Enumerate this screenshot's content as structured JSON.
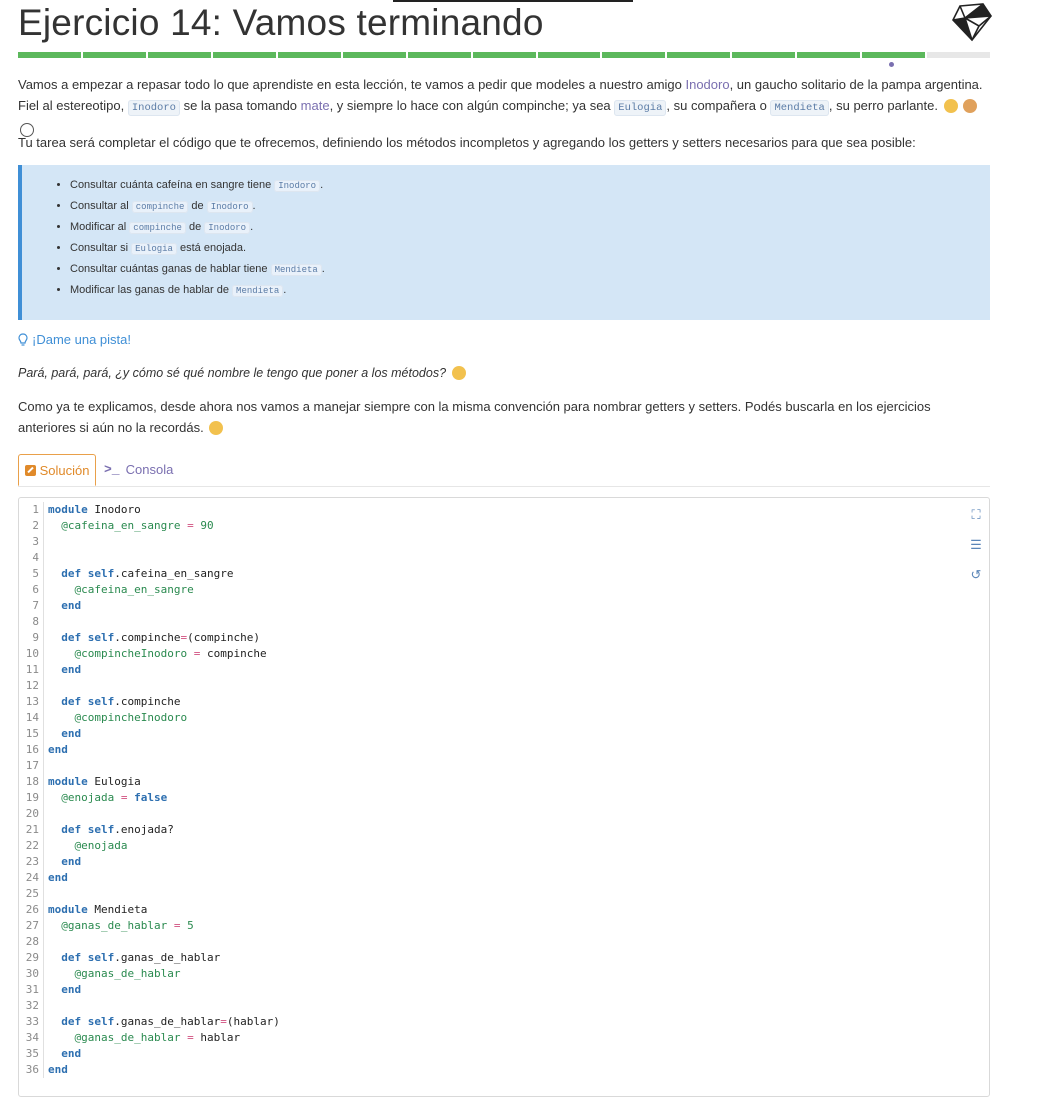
{
  "title": "Ejercicio 14: Vamos terminando",
  "progress": {
    "total": 15,
    "completed": 14,
    "current": 14
  },
  "intro": {
    "t1": "Vamos a empezar a repasar todo lo que aprendiste en esta lección, te vamos a pedir que modeles a nuestro amigo ",
    "link1": "Inodoro",
    "t2": ", un gaucho solitario de la pampa argentina. Fiel al estereotipo, ",
    "code1": "Inodoro",
    "t3": " se la pasa tomando ",
    "link2": "mate",
    "t4": ", y siempre lo hace con algún compinche; ya sea ",
    "code2": "Eulogia",
    "t5": ", su compañera o ",
    "code3": "Mendieta",
    "t6": ", su perro parlante."
  },
  "task": "Tu tarea será completar el código que te ofrecemos, definiendo los métodos incompletos y agregando los getters y setters necesarios para que sea posible:",
  "bullets": [
    {
      "pre": "Consultar cuánta cafeína en sangre tiene ",
      "c1": "Inodoro",
      "mid": "",
      "c2": "",
      "post": "."
    },
    {
      "pre": "Consultar al ",
      "c1": "compinche",
      "mid": " de ",
      "c2": "Inodoro",
      "post": "."
    },
    {
      "pre": "Modificar al ",
      "c1": "compinche",
      "mid": " de ",
      "c2": "Inodoro",
      "post": "."
    },
    {
      "pre": "Consultar si ",
      "c1": "Eulogia",
      "mid": " está enojada.",
      "c2": "",
      "post": ""
    },
    {
      "pre": "Consultar cuántas ganas de hablar tiene ",
      "c1": "Mendieta",
      "mid": "",
      "c2": "",
      "post": "."
    },
    {
      "pre": "Modificar las ganas de hablar de ",
      "c1": "Mendieta",
      "mid": "",
      "c2": "",
      "post": "."
    }
  ],
  "hint_label": "¡Dame una pista!",
  "hint_text": "Pará, pará, pará, ¿y cómo sé qué nombre le tengo que poner a los métodos?",
  "explain": "Como ya te explicamos, desde ahora nos vamos a manejar siempre con la misma convención para nombrar getters y setters. Podés buscarla en los ejercicios anteriores si aún no la recordás.",
  "tabs": {
    "solution": "Solución",
    "console": "Consola"
  },
  "code": [
    "module Inodoro",
    "  @cafeina_en_sangre = 90",
    "",
    "",
    "  def self.cafeina_en_sangre",
    "    @cafeina_en_sangre",
    "  end",
    "",
    "  def self.compinche=(compinche)",
    "    @compincheInodoro = compinche",
    "  end",
    "",
    "  def self.compinche",
    "    @compincheInodoro",
    "  end",
    "end",
    "",
    "module Eulogia",
    "  @enojada = false",
    "",
    "  def self.enojada?",
    "    @enojada",
    "  end",
    "end",
    "",
    "module Mendieta",
    "  @ganas_de_hablar = 5",
    "",
    "  def self.ganas_de_hablar",
    "    @ganas_de_hablar",
    "  end",
    "",
    "  def self.ganas_de_hablar=(hablar)",
    "    @ganas_de_hablar = hablar",
    "  end",
    "end"
  ],
  "colors": {
    "accent": "#7a6fb0",
    "progress": "#5cb85c",
    "info_bg": "#d4e6f6",
    "info_border": "#3f8fd6",
    "tab_active": "#e08a2a"
  },
  "icons": [
    "ruby-logo-icon",
    "lightbulb-icon",
    "pencil-icon",
    "terminal-icon",
    "fullscreen-icon",
    "indent-icon",
    "reset-icon"
  ]
}
